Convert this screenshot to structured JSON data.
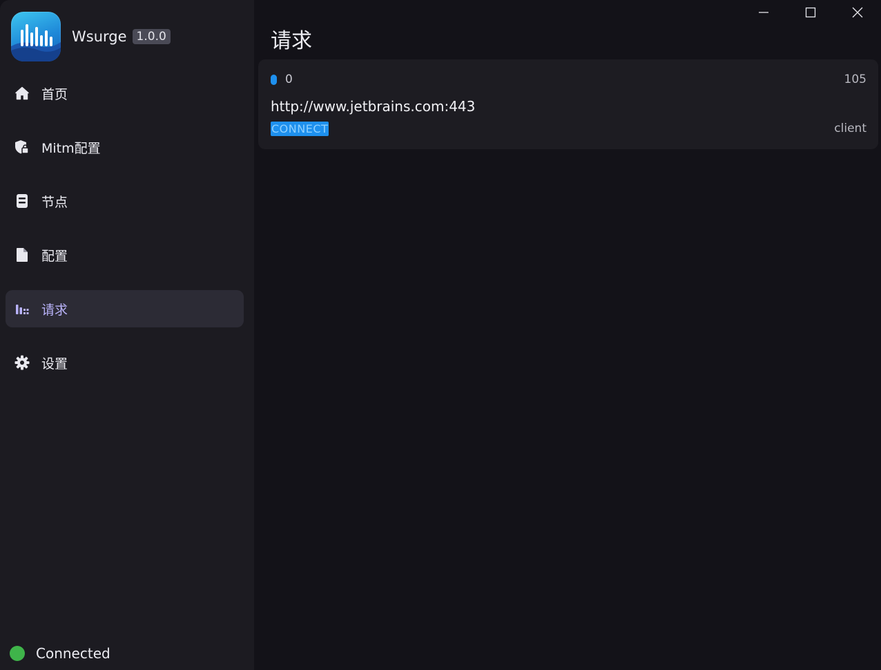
{
  "app": {
    "name": "Wsurge",
    "version": "1.0.0"
  },
  "sidebar": {
    "items": [
      {
        "label": "首页",
        "icon": "home-icon",
        "active": false
      },
      {
        "label": "Mitm配置",
        "icon": "shield-lock-icon",
        "active": false
      },
      {
        "label": "节点",
        "icon": "server-icon",
        "active": false
      },
      {
        "label": "配置",
        "icon": "file-icon",
        "active": false
      },
      {
        "label": "请求",
        "icon": "bar-chart-icon",
        "active": true
      },
      {
        "label": "设置",
        "icon": "gear-icon",
        "active": false
      }
    ]
  },
  "status": {
    "text": "Connected",
    "color": "#3fb44a"
  },
  "main": {
    "title": "请求"
  },
  "requests": [
    {
      "index": "0",
      "size": "105",
      "url": "http://www.jetbrains.com:443",
      "method": "CONNECT",
      "source": "client"
    }
  ],
  "colors": {
    "accent": "#1e90ee",
    "active_nav_text": "#b8b2f8",
    "connected": "#3fb44a"
  }
}
